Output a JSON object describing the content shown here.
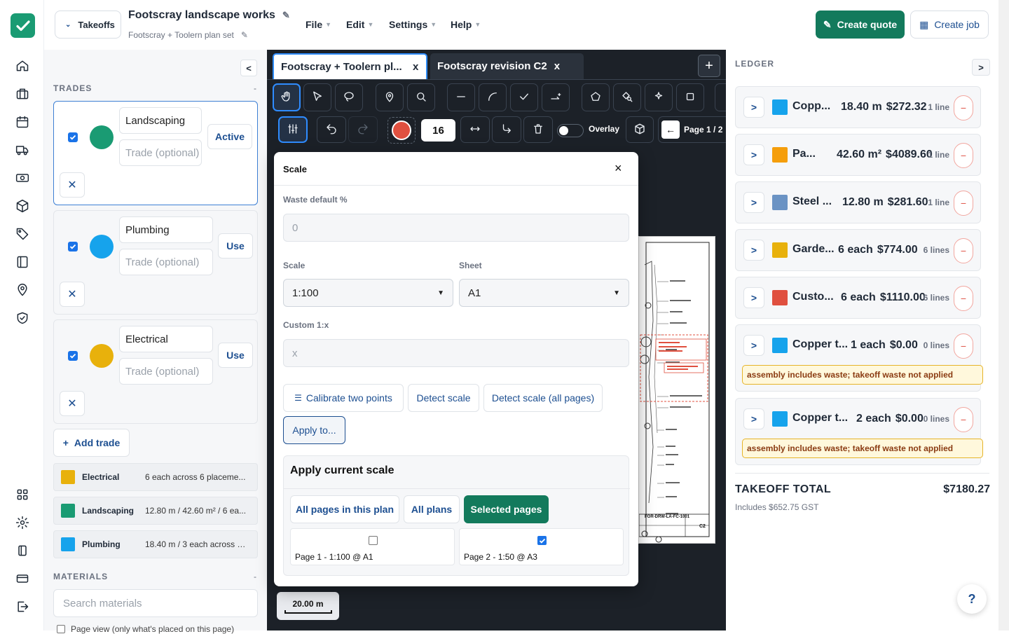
{
  "topbar": {
    "takeoffs_label": "Takeoffs",
    "project_title": "Footscray landscape works",
    "plan_set": "Footscray + Toolern plan set",
    "menus": [
      "File",
      "Edit",
      "Settings",
      "Help"
    ],
    "create_quote": "Create quote",
    "create_job": "Create job"
  },
  "left": {
    "collapse_label": "<",
    "trades_heading": "TRADES",
    "trades_toggle": "-",
    "trades": [
      {
        "name": "Landscaping",
        "placeholder": "Trade (optional)",
        "button": "Active",
        "color": "#1a9b73"
      },
      {
        "name": "Plumbing",
        "placeholder": "Trade (optional)",
        "button": "Use",
        "color": "#16a3ec"
      },
      {
        "name": "Electrical",
        "placeholder": "Trade (optional)",
        "button": "Use",
        "color": "#e8b10c"
      }
    ],
    "add_trade": "Add trade",
    "summary": [
      {
        "name": "Electrical",
        "desc": "6 each across 6 placeme...",
        "color": "#e8b10c"
      },
      {
        "name": "Landscaping",
        "desc": "12.80 m / 42.60 m² / 6 ea...",
        "color": "#1a9b73"
      },
      {
        "name": "Plumbing",
        "desc": "18.40 m / 3 each across 1...",
        "color": "#16a3ec"
      }
    ],
    "materials_heading": "MATERIALS",
    "materials_toggle": "-",
    "search_placeholder": "Search materials",
    "page_view_label": "Page view (only what's placed on this page)"
  },
  "canvas": {
    "tabs": [
      {
        "label": "Footscray + Toolern pl...",
        "close": "x"
      },
      {
        "label": "Footscray revision C2",
        "close": "x"
      }
    ],
    "add_tab": "+",
    "stroke_width": "16",
    "overlay_label": "Overlay",
    "page_label": "Page 1 / 2",
    "scale_bar": "20.00 m",
    "drawing_code": "FOR-DRW-LA-FC-1001",
    "drawing_rev": "C2",
    "color_current": "#e0503f"
  },
  "scale_modal": {
    "title": "Scale",
    "close": "×",
    "waste_label": "Waste default %",
    "waste_value": "0",
    "scale_label": "Scale",
    "scale_value": "1:100",
    "sheet_label": "Sheet",
    "sheet_value": "A1",
    "custom_label": "Custom 1:x",
    "custom_placeholder": "x",
    "calibrate": "Calibrate two points",
    "detect": "Detect scale",
    "detect_all": "Detect scale (all pages)",
    "apply_to": "Apply to...",
    "apply_heading": "Apply current scale",
    "apply_options": [
      "All pages in this plan",
      "All plans",
      "Selected pages"
    ],
    "pages": [
      {
        "label": "Page 1 - 1:100 @ A1",
        "checked": false
      },
      {
        "label": "Page 2 - 1:50 @ A3",
        "checked": true
      }
    ]
  },
  "ledger": {
    "heading": "LEDGER",
    "toggle": ">",
    "rows": [
      {
        "name": "Copp...",
        "qty": "18.40 m",
        "price": "$272.32",
        "lines": "1 line",
        "color": "#16a3ec",
        "warning": ""
      },
      {
        "name": "Pa...",
        "qty": "42.60 m²",
        "price": "$4089.60",
        "lines": "1 line",
        "color": "#f59e0b",
        "warning": ""
      },
      {
        "name": "Steel ...",
        "qty": "12.80 m",
        "price": "$281.60",
        "lines": "1 line",
        "color": "#6b93c4",
        "warning": ""
      },
      {
        "name": "Garde...",
        "qty": "6 each",
        "price": "$774.00",
        "lines": "6 lines",
        "color": "#e8b10c",
        "warning": ""
      },
      {
        "name": "Custo...",
        "qty": "6 each",
        "price": "$1110.00",
        "lines": "6 lines",
        "color": "#e0503f",
        "warning": ""
      },
      {
        "name": "Copper t...",
        "qty": "1 each",
        "price": "$0.00",
        "lines": "0 lines",
        "color": "#16a3ec",
        "warning": "assembly includes waste; takeoff waste not applied"
      },
      {
        "name": "Copper t...",
        "qty": "2 each",
        "price": "$0.00",
        "lines": "0 lines",
        "color": "#16a3ec",
        "warning": "assembly includes waste; takeoff waste not applied"
      }
    ],
    "expand_label": ">",
    "remove_label": "−",
    "total_label": "TAKEOFF TOTAL",
    "total_value": "$7180.27",
    "gst_note": "Includes $652.75 GST",
    "help": "?"
  }
}
